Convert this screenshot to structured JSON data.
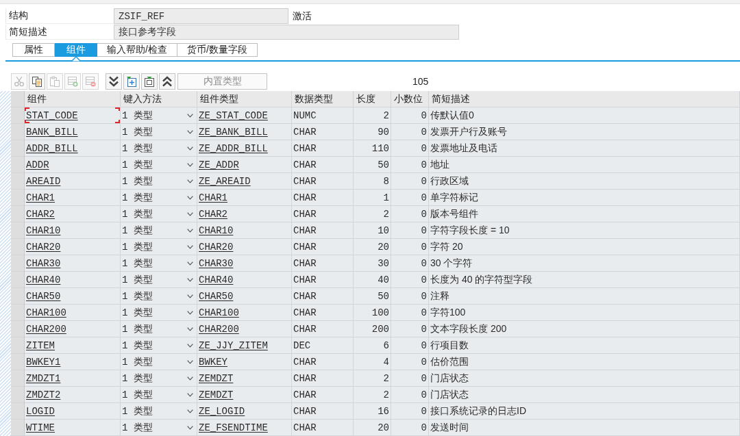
{
  "structure": {
    "label": "结构",
    "value": "ZSIF_REF",
    "status": "激活"
  },
  "short_description": {
    "label": "简短描述",
    "value": "接口参考字段"
  },
  "tabs": [
    {
      "label": "属性",
      "selected": false
    },
    {
      "label": "组件",
      "selected": true
    },
    {
      "label": "输入帮助/检查",
      "selected": false
    },
    {
      "label": "货币/数量字段",
      "selected": false
    }
  ],
  "toolbar": [
    {
      "buttons": [
        {
          "kind": "cut",
          "disabled": true
        },
        {
          "kind": "copy",
          "disabled": false
        },
        {
          "kind": "paste",
          "disabled": true
        },
        {
          "kind": "insert_row",
          "disabled": true
        },
        {
          "kind": "delete_row",
          "disabled": true
        }
      ]
    },
    {
      "buttons": [
        {
          "kind": "expand_all",
          "disabled": false
        },
        {
          "kind": "insert_block",
          "disabled": false
        },
        {
          "kind": "select_block",
          "disabled": false
        },
        {
          "kind": "collapse_all",
          "disabled": false
        }
      ]
    }
  ],
  "builtin_type_button": {
    "label": "内置类型",
    "disabled": true
  },
  "counter": "105",
  "table": {
    "columns": [
      "组件",
      "键入方法",
      "组件类型",
      "数据类型",
      "长度",
      "小数位",
      "简短描述"
    ],
    "rows": [
      {
        "component": "STAT_CODE",
        "entry_method": "1 类型",
        "component_type": "ZE_STAT_CODE",
        "data_type": "NUMC",
        "length": "2",
        "decimals": "0",
        "description": "传默认值0",
        "focused": true
      },
      {
        "component": "BANK_BILL",
        "entry_method": "1 类型",
        "component_type": "ZE_BANK_BILL",
        "data_type": "CHAR",
        "length": "90",
        "decimals": "0",
        "description": "发票开户行及账号",
        "focused": false
      },
      {
        "component": "ADDR_BILL",
        "entry_method": "1 类型",
        "component_type": "ZE_ADDR_BILL",
        "data_type": "CHAR",
        "length": "110",
        "decimals": "0",
        "description": "发票地址及电话",
        "focused": false
      },
      {
        "component": "ADDR",
        "entry_method": "1 类型",
        "component_type": "ZE_ADDR",
        "data_type": "CHAR",
        "length": "50",
        "decimals": "0",
        "description": "地址",
        "focused": false
      },
      {
        "component": "AREAID",
        "entry_method": "1 类型",
        "component_type": "ZE_AREAID",
        "data_type": "CHAR",
        "length": "8",
        "decimals": "0",
        "description": "行政区域",
        "focused": false
      },
      {
        "component": "CHAR1",
        "entry_method": "1 类型",
        "component_type": "CHAR1",
        "data_type": "CHAR",
        "length": "1",
        "decimals": "0",
        "description": "单字符标记",
        "focused": false
      },
      {
        "component": "CHAR2",
        "entry_method": "1 类型",
        "component_type": "CHAR2",
        "data_type": "CHAR",
        "length": "2",
        "decimals": "0",
        "description": "版本号组件",
        "focused": false
      },
      {
        "component": "CHAR10",
        "entry_method": "1 类型",
        "component_type": "CHAR10",
        "data_type": "CHAR",
        "length": "10",
        "decimals": "0",
        "description": "字符字段长度 = 10",
        "focused": false
      },
      {
        "component": "CHAR20",
        "entry_method": "1 类型",
        "component_type": "CHAR20",
        "data_type": "CHAR",
        "length": "20",
        "decimals": "0",
        "description": "字符 20",
        "focused": false
      },
      {
        "component": "CHAR30",
        "entry_method": "1 类型",
        "component_type": "CHAR30",
        "data_type": "CHAR",
        "length": "30",
        "decimals": "0",
        "description": "30 个字符",
        "focused": false
      },
      {
        "component": "CHAR40",
        "entry_method": "1 类型",
        "component_type": "CHAR40",
        "data_type": "CHAR",
        "length": "40",
        "decimals": "0",
        "description": "长度为 40 的字符型字段",
        "focused": false
      },
      {
        "component": "CHAR50",
        "entry_method": "1 类型",
        "component_type": "CHAR50",
        "data_type": "CHAR",
        "length": "50",
        "decimals": "0",
        "description": "注释",
        "focused": false
      },
      {
        "component": "CHAR100",
        "entry_method": "1 类型",
        "component_type": "CHAR100",
        "data_type": "CHAR",
        "length": "100",
        "decimals": "0",
        "description": "字符100",
        "focused": false
      },
      {
        "component": "CHAR200",
        "entry_method": "1 类型",
        "component_type": "CHAR200",
        "data_type": "CHAR",
        "length": "200",
        "decimals": "0",
        "description": "文本字段长度 200",
        "focused": false
      },
      {
        "component": "ZITEM",
        "entry_method": "1 类型",
        "component_type": "ZE_JJY_ZITEM",
        "data_type": "DEC",
        "length": "6",
        "decimals": "0",
        "description": "行项目数",
        "focused": false
      },
      {
        "component": "BWKEY1",
        "entry_method": "1 类型",
        "component_type": "BWKEY",
        "data_type": "CHAR",
        "length": "4",
        "decimals": "0",
        "description": "估价范围",
        "focused": false
      },
      {
        "component": "ZMDZT1",
        "entry_method": "1 类型",
        "component_type": "ZEMDZT",
        "data_type": "CHAR",
        "length": "2",
        "decimals": "0",
        "description": "门店状态",
        "focused": false
      },
      {
        "component": "ZMDZT2",
        "entry_method": "1 类型",
        "component_type": "ZEMDZT",
        "data_type": "CHAR",
        "length": "2",
        "decimals": "0",
        "description": "门店状态",
        "focused": false
      },
      {
        "component": "LOGID",
        "entry_method": "1 类型",
        "component_type": "ZE_LOGID",
        "data_type": "CHAR",
        "length": "16",
        "decimals": "0",
        "description": "接口系统记录的日志ID",
        "focused": false
      },
      {
        "component": "WTIME",
        "entry_method": "1 类型",
        "component_type": "ZE_FSENDTIME",
        "data_type": "CHAR",
        "length": "20",
        "decimals": "0",
        "description": "发送时间",
        "focused": false
      }
    ]
  }
}
